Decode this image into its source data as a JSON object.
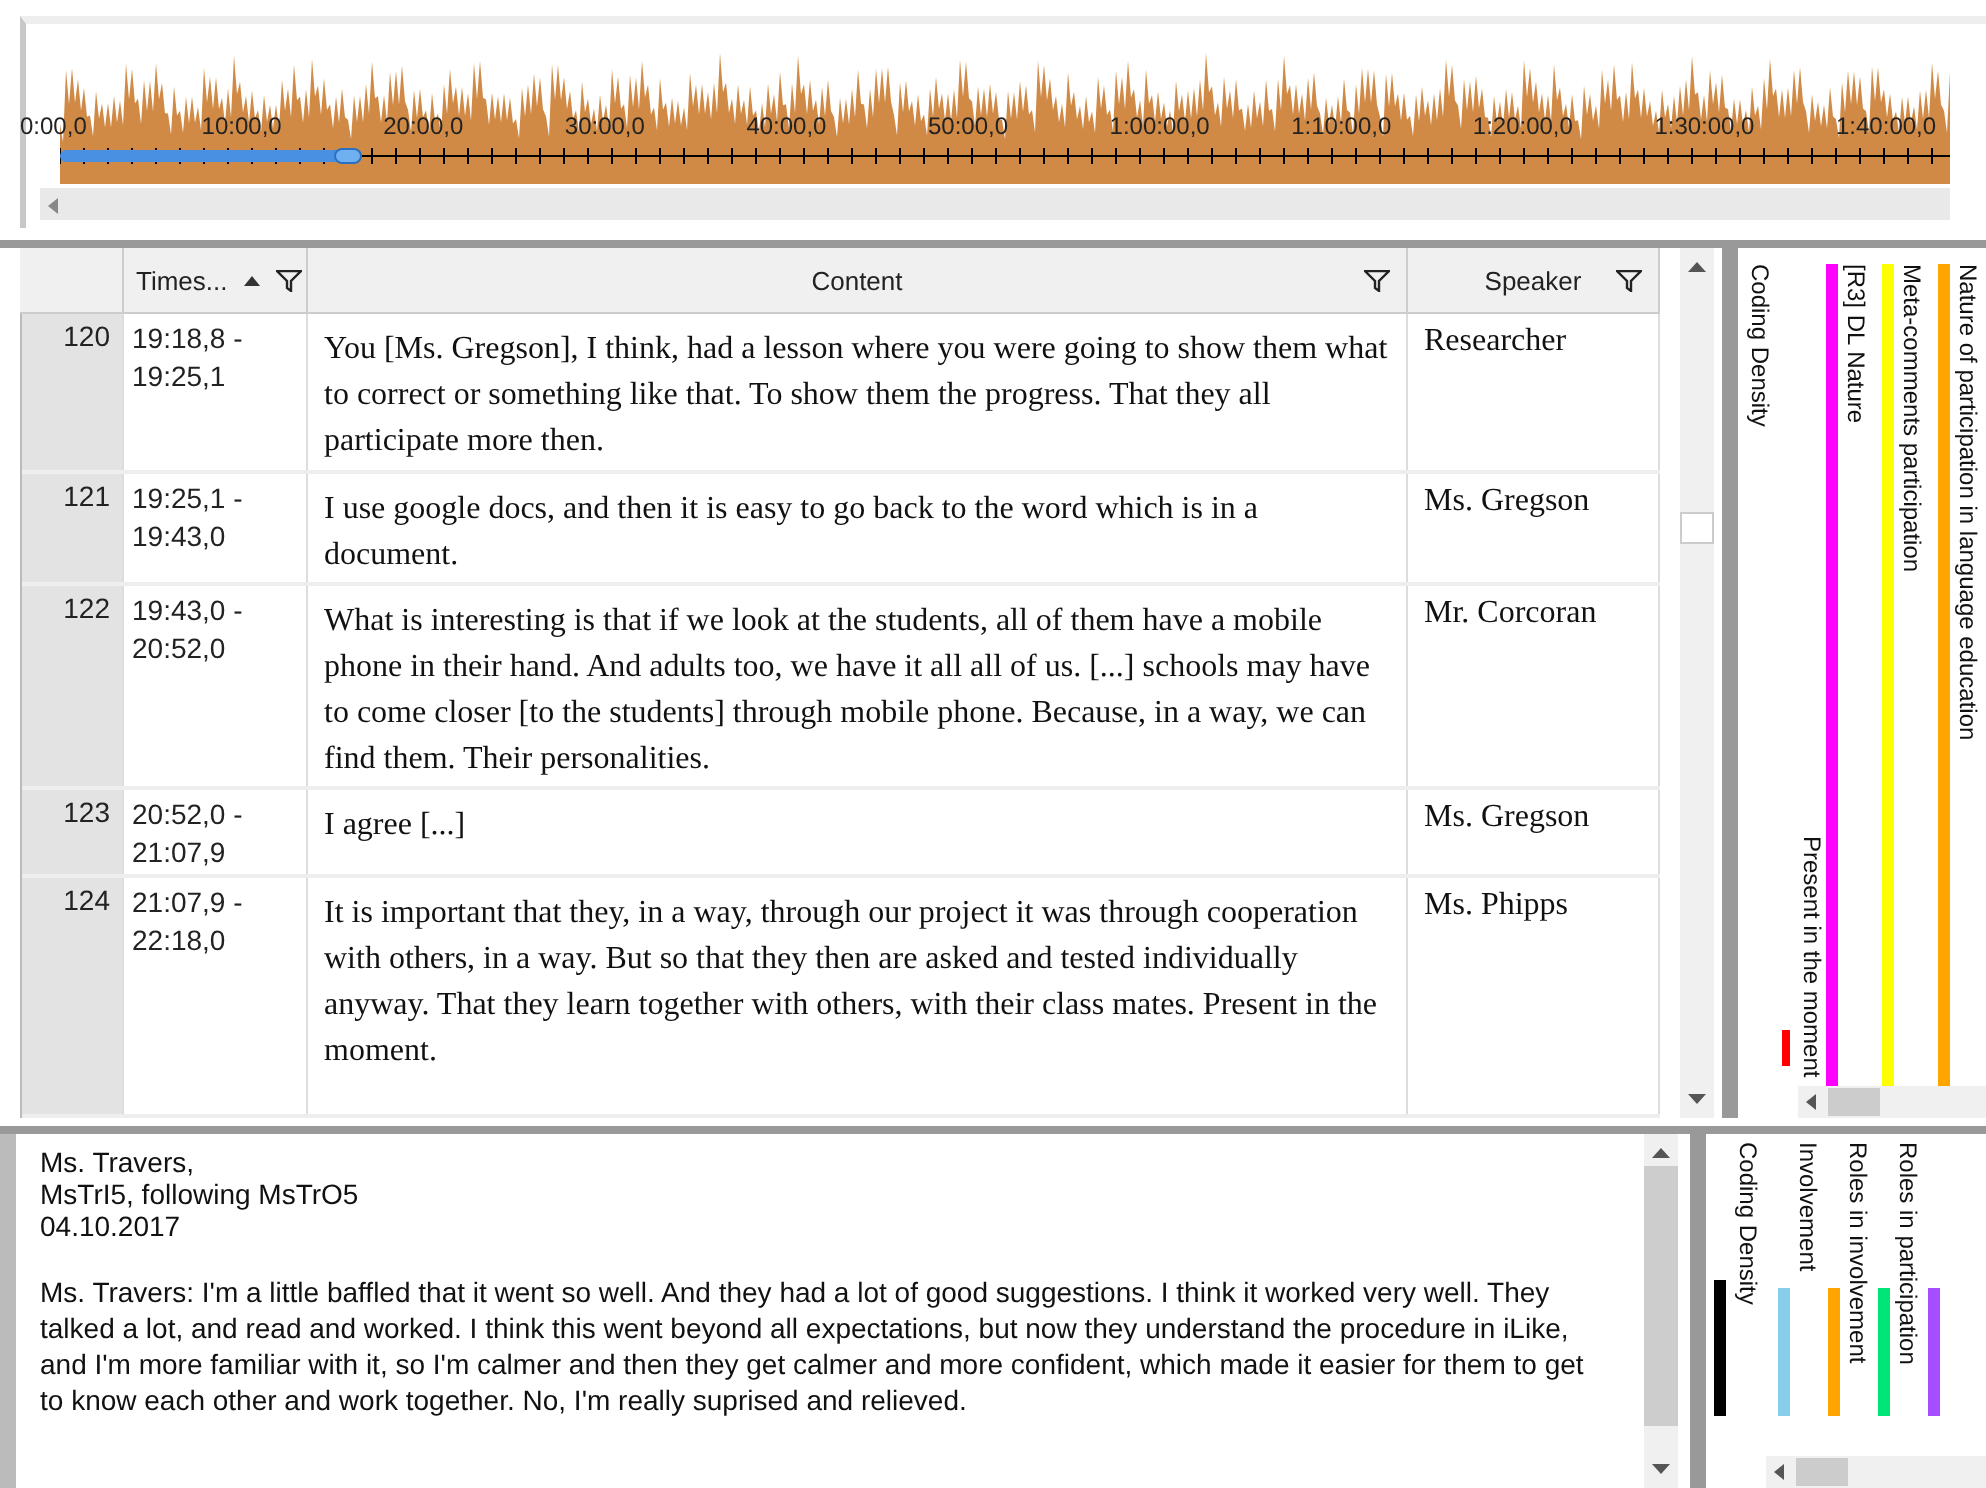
{
  "timeline": {
    "ticks": [
      "0:00,0",
      "10:00,0",
      "20:00,0",
      "30:00,0",
      "40:00,0",
      "50:00,0",
      "1:00:00,0",
      "1:10:00,0",
      "1:20:00,0",
      "1:30:00,0",
      "1:40:00,0"
    ]
  },
  "table": {
    "columns": [
      {
        "kind": "rownum"
      },
      {
        "label": "Times...",
        "kind": "sorted"
      },
      {
        "label": "Content",
        "kind": "filter"
      },
      {
        "label": "Speaker",
        "kind": "filter"
      }
    ],
    "rows": [
      {
        "num": "120",
        "time": [
          "19:18,8 -",
          "19:25,1"
        ],
        "content": "You [Ms. Gregson], I think, had a lesson where you were going to show them what to correct or something like that. To show them the progress. That they all participate more then.",
        "speaker": "Researcher"
      },
      {
        "num": "121",
        "time": [
          "19:25,1 -",
          "19:43,0"
        ],
        "content": "I use google docs, and then it is easy to go back to the word which is in a document.",
        "speaker": "Ms. Gregson"
      },
      {
        "num": "122",
        "time": [
          "19:43,0 -",
          "20:52,0"
        ],
        "content": "What is interesting is that if we look at the students, all of them have a mobile phone in their hand. And adults too, we have it all all of us. [...] schools may have to come closer [to the students] through mobile phone. Because, in a way, we can find them. Their personalities.",
        "speaker": "Mr. Corcoran"
      },
      {
        "num": "123",
        "time": [
          "20:52,0 -",
          "21:07,9"
        ],
        "content": "I agree [...]",
        "speaker": "Ms. Gregson"
      },
      {
        "num": "124",
        "time": [
          "21:07,9 -",
          "22:18,0"
        ],
        "content": "It is important that they, in a way, through our project it was through cooperation with others, in a way. But so that they then are asked and tested individually anyway. That they learn together with others, with their class mates. Present in the moment.",
        "speaker": "Ms. Phipps"
      }
    ]
  },
  "top_stripes": [
    {
      "label": "Coding Density",
      "kind": "density"
    },
    {
      "label": "Present in the moment",
      "kind": "short",
      "color": "#ff0000"
    },
    {
      "label": "[R3] DL Nature",
      "kind": "full",
      "color": "#ff00ff"
    },
    {
      "label": "Meta-comments participation",
      "kind": "full",
      "color": "#ffff00"
    },
    {
      "label": "Nature of participation in language education",
      "kind": "full",
      "color": "#ffa500"
    }
  ],
  "document": {
    "header": [
      "Ms. Travers,",
      "MsTrI5, following MsTrO5",
      "04.10.2017"
    ],
    "paragraph": "Ms. Travers: I'm a little baffled that it went so well. And they had a lot of good suggestions. I think it worked very well. They talked a lot, and read and worked. I think this went beyond all expectations, but now they understand the procedure in iLike, and I'm more familiar with it, so I'm calmer and then they get calmer and more confident, which made it easier for them to get to know each other and work together. No, I'm really suprised and relieved."
  },
  "bottom_stripes": [
    {
      "label": "Coding Density",
      "kind": "density",
      "color": "#000000"
    },
    {
      "label": "Involvement",
      "kind": "full",
      "color": "#87ceeb"
    },
    {
      "label": "Roles in involvement",
      "kind": "full",
      "color": "#ffa500"
    },
    {
      "label": "Roles in participation",
      "kind": "full",
      "color": "#00e676"
    },
    {
      "kind": "full",
      "color": "#a64dff"
    }
  ]
}
